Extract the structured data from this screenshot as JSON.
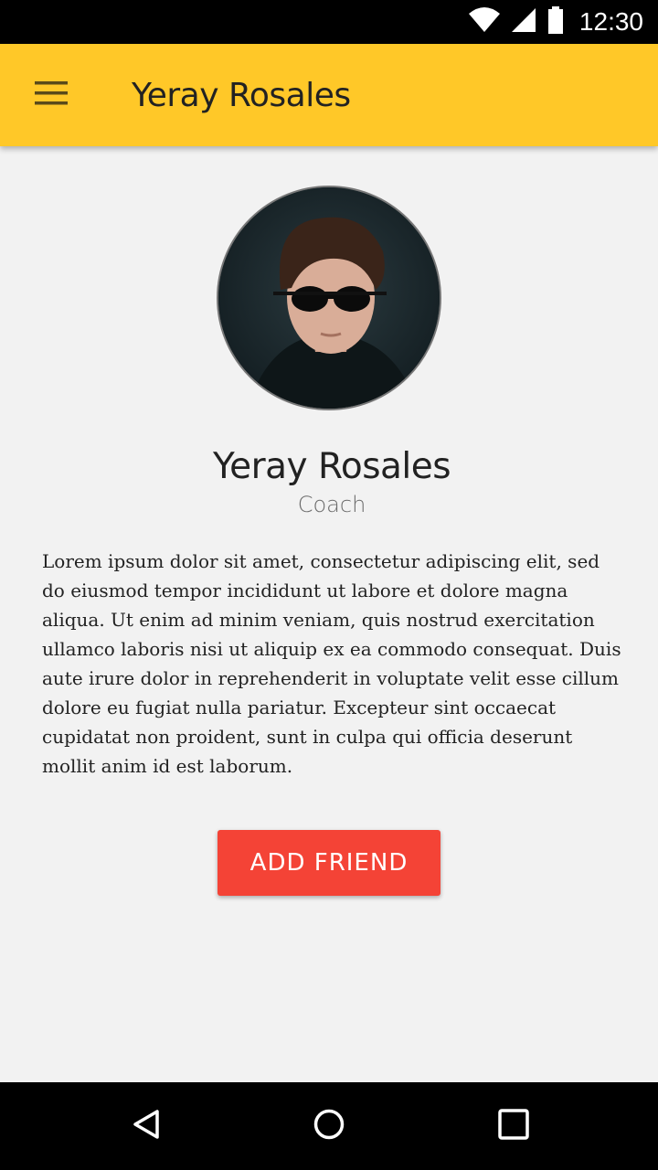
{
  "status_bar": {
    "time": "12:30",
    "icons": [
      "wifi-icon",
      "cellular-signal-icon",
      "battery-icon"
    ]
  },
  "app_bar": {
    "title": "Yeray Rosales",
    "menu_icon": "hamburger-menu-icon",
    "background_color": "#ffc828"
  },
  "profile": {
    "name": "Yeray Rosales",
    "role": "Coach",
    "bio": "Lorem ipsum dolor sit amet, consectetur adipiscing elit, sed do eiusmod tempor incididunt ut labore et dolore magna aliqua. Ut enim ad minim veniam, quis nostrud exercitation ullamco laboris nisi ut aliquip ex ea commodo consequat. Duis aute irure dolor in reprehenderit in voluptate velit esse cillum dolore eu fugiat nulla pariatur. Excepteur sint occaecat cupidatat non proident, sunt in culpa qui officia deserunt mollit anim id est laborum."
  },
  "actions": {
    "add_friend_label": "ADD FRIEND",
    "add_friend_color": "#f44336"
  },
  "nav_bar": {
    "icons": [
      "back-icon",
      "home-icon",
      "recents-icon"
    ]
  }
}
